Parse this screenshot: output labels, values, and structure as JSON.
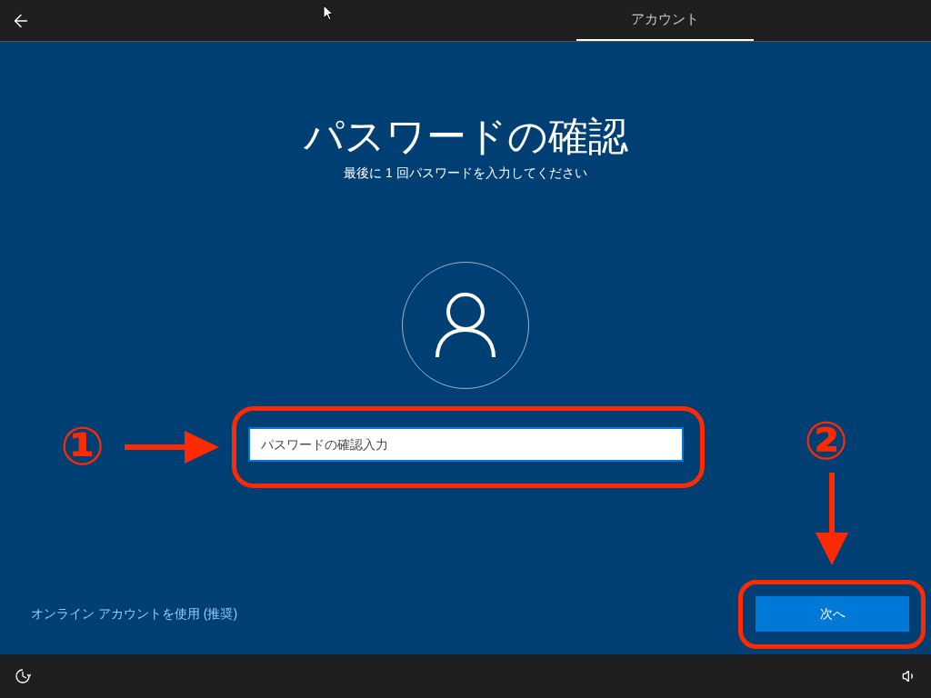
{
  "header": {
    "tabs": [
      {
        "label": "アカウント",
        "selected": true
      }
    ]
  },
  "title": "パスワードの確認",
  "subtitle": "最後に 1 回パスワードを入力してください",
  "password_field": {
    "placeholder": "パスワードの確認入力",
    "focused": true
  },
  "link": "オンライン アカウントを使用 (推奨)",
  "next_button": "次へ",
  "annotations": [
    {
      "label": "①"
    },
    {
      "label": "②"
    }
  ]
}
